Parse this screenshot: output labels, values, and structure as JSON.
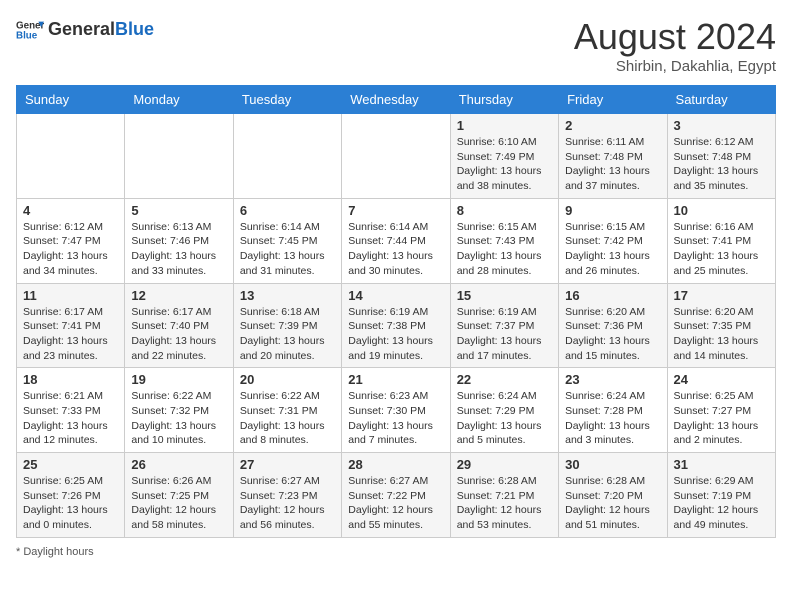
{
  "header": {
    "logo_line1": "General",
    "logo_line2": "Blue",
    "main_title": "August 2024",
    "subtitle": "Shirbin, Dakahlia, Egypt"
  },
  "days_of_week": [
    "Sunday",
    "Monday",
    "Tuesday",
    "Wednesday",
    "Thursday",
    "Friday",
    "Saturday"
  ],
  "weeks": [
    [
      {
        "day": "",
        "info": ""
      },
      {
        "day": "",
        "info": ""
      },
      {
        "day": "",
        "info": ""
      },
      {
        "day": "",
        "info": ""
      },
      {
        "day": "1",
        "info": "Sunrise: 6:10 AM\nSunset: 7:49 PM\nDaylight: 13 hours and 38 minutes."
      },
      {
        "day": "2",
        "info": "Sunrise: 6:11 AM\nSunset: 7:48 PM\nDaylight: 13 hours and 37 minutes."
      },
      {
        "day": "3",
        "info": "Sunrise: 6:12 AM\nSunset: 7:48 PM\nDaylight: 13 hours and 35 minutes."
      }
    ],
    [
      {
        "day": "4",
        "info": "Sunrise: 6:12 AM\nSunset: 7:47 PM\nDaylight: 13 hours and 34 minutes."
      },
      {
        "day": "5",
        "info": "Sunrise: 6:13 AM\nSunset: 7:46 PM\nDaylight: 13 hours and 33 minutes."
      },
      {
        "day": "6",
        "info": "Sunrise: 6:14 AM\nSunset: 7:45 PM\nDaylight: 13 hours and 31 minutes."
      },
      {
        "day": "7",
        "info": "Sunrise: 6:14 AM\nSunset: 7:44 PM\nDaylight: 13 hours and 30 minutes."
      },
      {
        "day": "8",
        "info": "Sunrise: 6:15 AM\nSunset: 7:43 PM\nDaylight: 13 hours and 28 minutes."
      },
      {
        "day": "9",
        "info": "Sunrise: 6:15 AM\nSunset: 7:42 PM\nDaylight: 13 hours and 26 minutes."
      },
      {
        "day": "10",
        "info": "Sunrise: 6:16 AM\nSunset: 7:41 PM\nDaylight: 13 hours and 25 minutes."
      }
    ],
    [
      {
        "day": "11",
        "info": "Sunrise: 6:17 AM\nSunset: 7:41 PM\nDaylight: 13 hours and 23 minutes."
      },
      {
        "day": "12",
        "info": "Sunrise: 6:17 AM\nSunset: 7:40 PM\nDaylight: 13 hours and 22 minutes."
      },
      {
        "day": "13",
        "info": "Sunrise: 6:18 AM\nSunset: 7:39 PM\nDaylight: 13 hours and 20 minutes."
      },
      {
        "day": "14",
        "info": "Sunrise: 6:19 AM\nSunset: 7:38 PM\nDaylight: 13 hours and 19 minutes."
      },
      {
        "day": "15",
        "info": "Sunrise: 6:19 AM\nSunset: 7:37 PM\nDaylight: 13 hours and 17 minutes."
      },
      {
        "day": "16",
        "info": "Sunrise: 6:20 AM\nSunset: 7:36 PM\nDaylight: 13 hours and 15 minutes."
      },
      {
        "day": "17",
        "info": "Sunrise: 6:20 AM\nSunset: 7:35 PM\nDaylight: 13 hours and 14 minutes."
      }
    ],
    [
      {
        "day": "18",
        "info": "Sunrise: 6:21 AM\nSunset: 7:33 PM\nDaylight: 13 hours and 12 minutes."
      },
      {
        "day": "19",
        "info": "Sunrise: 6:22 AM\nSunset: 7:32 PM\nDaylight: 13 hours and 10 minutes."
      },
      {
        "day": "20",
        "info": "Sunrise: 6:22 AM\nSunset: 7:31 PM\nDaylight: 13 hours and 8 minutes."
      },
      {
        "day": "21",
        "info": "Sunrise: 6:23 AM\nSunset: 7:30 PM\nDaylight: 13 hours and 7 minutes."
      },
      {
        "day": "22",
        "info": "Sunrise: 6:24 AM\nSunset: 7:29 PM\nDaylight: 13 hours and 5 minutes."
      },
      {
        "day": "23",
        "info": "Sunrise: 6:24 AM\nSunset: 7:28 PM\nDaylight: 13 hours and 3 minutes."
      },
      {
        "day": "24",
        "info": "Sunrise: 6:25 AM\nSunset: 7:27 PM\nDaylight: 13 hours and 2 minutes."
      }
    ],
    [
      {
        "day": "25",
        "info": "Sunrise: 6:25 AM\nSunset: 7:26 PM\nDaylight: 13 hours and 0 minutes."
      },
      {
        "day": "26",
        "info": "Sunrise: 6:26 AM\nSunset: 7:25 PM\nDaylight: 12 hours and 58 minutes."
      },
      {
        "day": "27",
        "info": "Sunrise: 6:27 AM\nSunset: 7:23 PM\nDaylight: 12 hours and 56 minutes."
      },
      {
        "day": "28",
        "info": "Sunrise: 6:27 AM\nSunset: 7:22 PM\nDaylight: 12 hours and 55 minutes."
      },
      {
        "day": "29",
        "info": "Sunrise: 6:28 AM\nSunset: 7:21 PM\nDaylight: 12 hours and 53 minutes."
      },
      {
        "day": "30",
        "info": "Sunrise: 6:28 AM\nSunset: 7:20 PM\nDaylight: 12 hours and 51 minutes."
      },
      {
        "day": "31",
        "info": "Sunrise: 6:29 AM\nSunset: 7:19 PM\nDaylight: 12 hours and 49 minutes."
      }
    ]
  ],
  "footer": {
    "daylight_label": "Daylight hours"
  }
}
